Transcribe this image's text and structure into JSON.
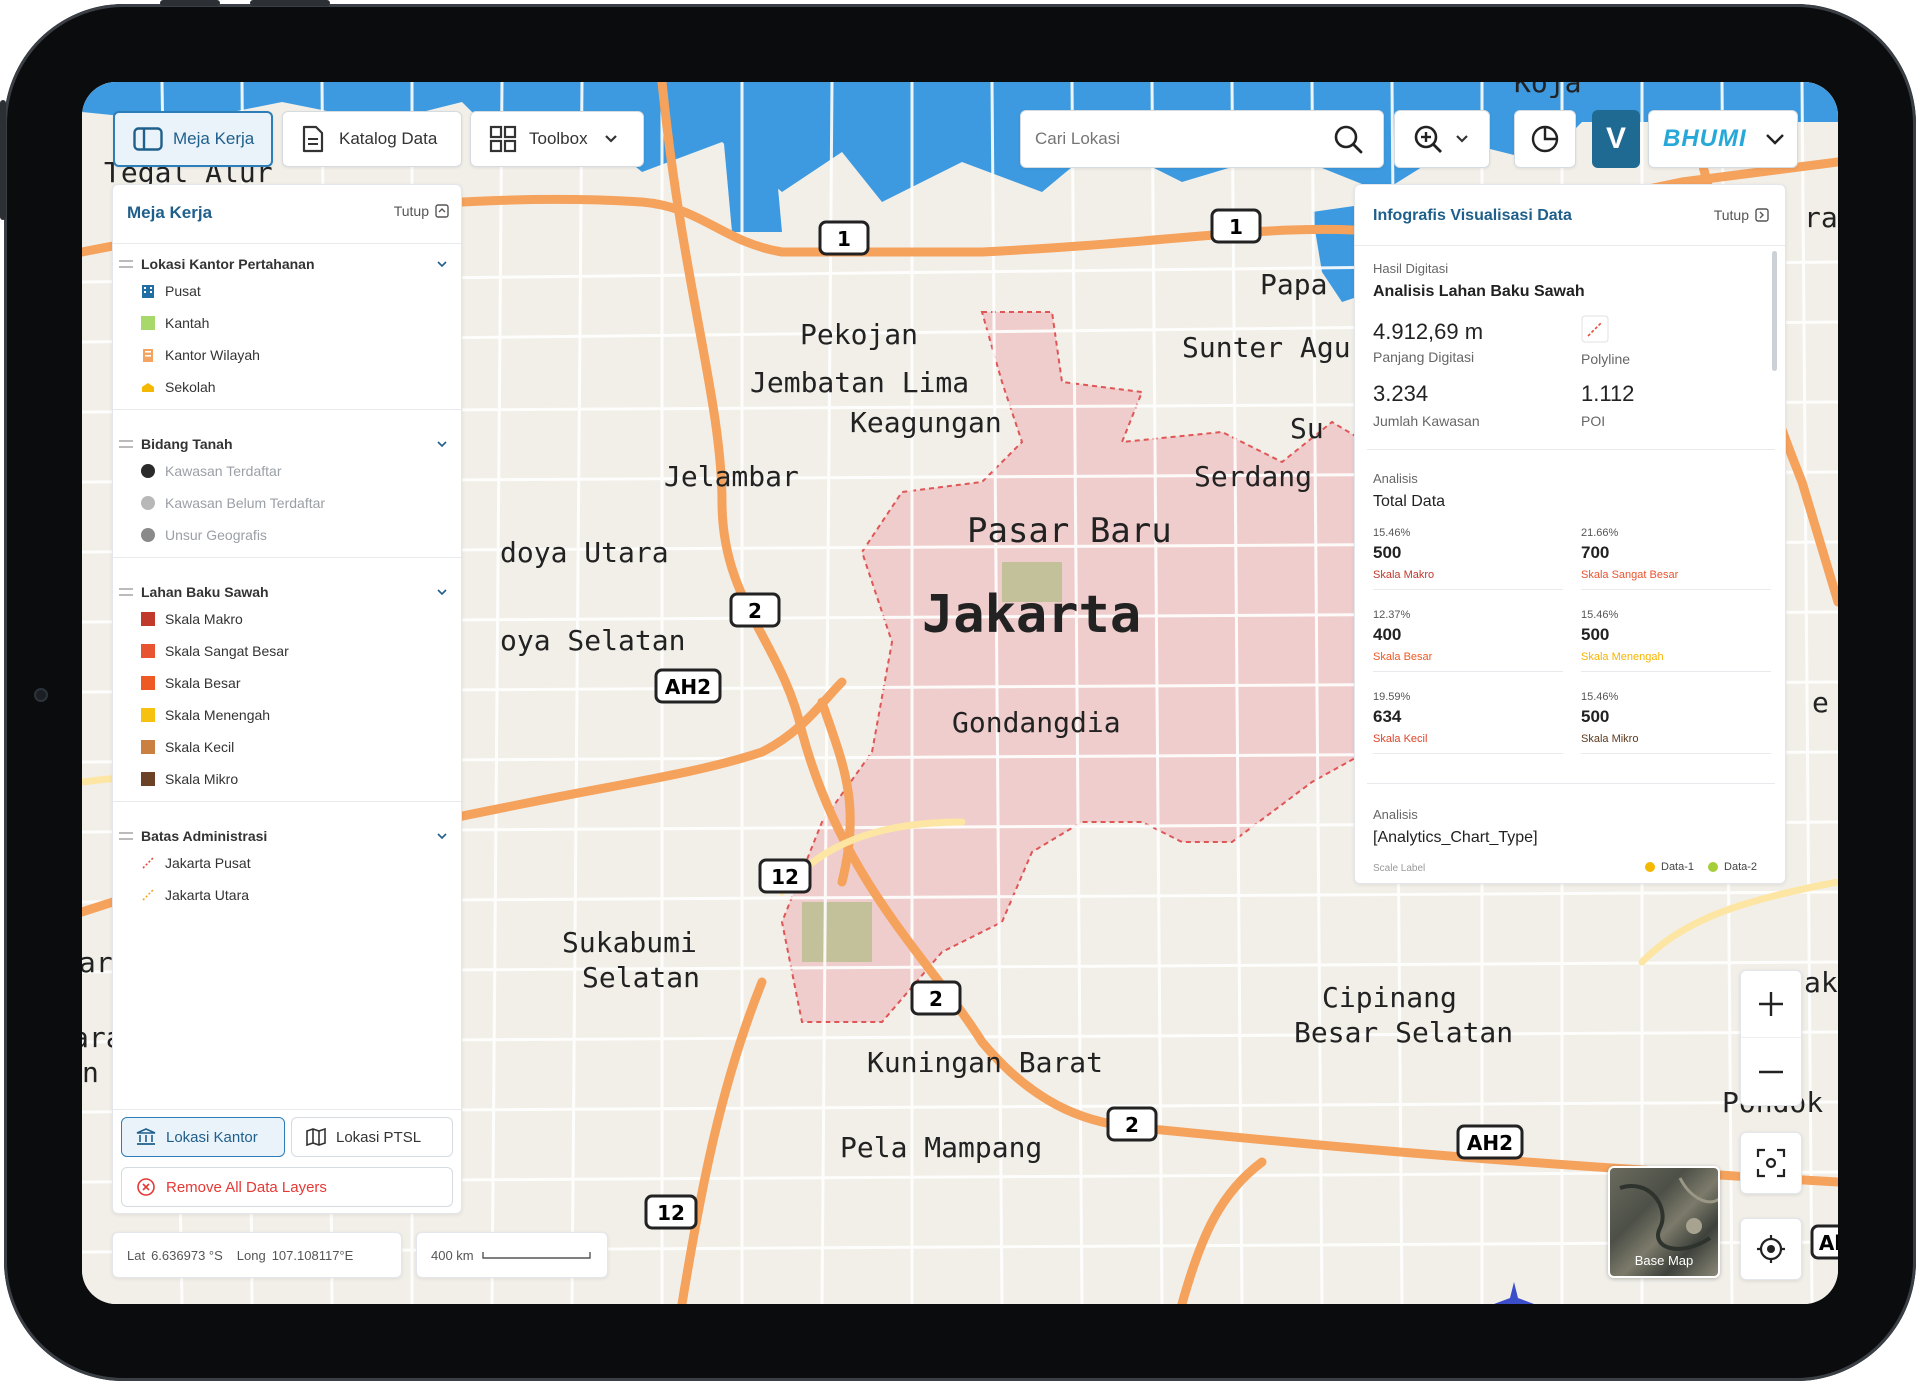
{
  "toolbar": {
    "meja_kerja": "Meja Kerja",
    "katalog_data": "Katalog Data",
    "toolbox": "Toolbox",
    "search_placeholder": "Cari Lokasi",
    "brand_initial": "V",
    "brand_name": "BHUMI"
  },
  "map_labels": {
    "city": "Jakarta",
    "pasar_baru": "Pasar Baru",
    "gondangdia": "Gondangdia",
    "pekojan": "Pekojan",
    "jembatan_lima": "Jembatan Lima",
    "keagungan": "Keagungan",
    "jelambar": "Jelambar",
    "serdang": "Serdang",
    "sunter": "Sunter Agu",
    "papa": "Papa",
    "su": "Su",
    "tegal_alur": "Tegal Alur",
    "doya_utara": "doya Utara",
    "oya_selatan": "oya Selatan",
    "sukabumi_1": "Sukabumi",
    "sukabumi_2": "Selatan",
    "cipinang_1": "Cipinang",
    "cipinang_2": "Besar Selatan",
    "kuningan": "Kuningan Barat",
    "pela": "Pela Mampang",
    "pondok": "Pondok K",
    "koja": "Koja",
    "edge_ra": "ra",
    "edge_e": "e",
    "edge_ak": "ak",
    "edge_ar": "Kar",
    "edge_ara": "ara",
    "edge_n": "n",
    "shields": [
      "1",
      "1",
      "2",
      "AH2",
      "12",
      "2",
      "2",
      "AH2",
      "12",
      "Al"
    ]
  },
  "sidebar": {
    "title": "Meja Kerja",
    "close": "Tutup",
    "groups": [
      {
        "title": "Lokasi Kantor Pertahanan",
        "items": [
          {
            "label": "Pusat",
            "color": "#1f6fa5",
            "icon": "building-icon"
          },
          {
            "label": "Kantah",
            "color": "#a6d96a",
            "icon": "square-icon"
          },
          {
            "label": "Kantor Wilayah",
            "color": "#f4a460",
            "icon": "office-icon"
          },
          {
            "label": "Sekolah",
            "color": "#f5b800",
            "icon": "school-icon"
          }
        ]
      },
      {
        "title": "Bidang Tanah",
        "items": [
          {
            "label": "Kawasan Terdaftar",
            "color": "#2b2b2b"
          },
          {
            "label": "Kawasan Belum Terdaftar",
            "color": "#b8b8b8"
          },
          {
            "label": "Unsur Geografis",
            "color": "#8a8a8a"
          }
        ]
      },
      {
        "title": "Lahan Baku Sawah",
        "items": [
          {
            "label": "Skala Makro",
            "color": "#c0392b"
          },
          {
            "label": "Skala Sangat Besar",
            "color": "#e8542f"
          },
          {
            "label": "Skala Besar",
            "color": "#ee5a24"
          },
          {
            "label": "Skala Menengah",
            "color": "#f7c10f"
          },
          {
            "label": "Skala Kecil",
            "color": "#c98040"
          },
          {
            "label": "Skala Mikro",
            "color": "#6b4226"
          }
        ]
      },
      {
        "title": "Batas Administrasi",
        "items": [
          {
            "label": "Jakarta Pusat",
            "color": "#e74c3c"
          },
          {
            "label": "Jakarta Utara",
            "color": "#f5a623"
          }
        ]
      }
    ],
    "tab_kantor": "Lokasi Kantor",
    "tab_ptsl": "Lokasi PTSL",
    "remove_all": "Remove All Data Layers"
  },
  "coords": {
    "lat_label": "Lat",
    "lat_value": "6.636973 °S",
    "long_label": "Long",
    "long_value": "107.108117°E",
    "scale": "400 km"
  },
  "infopanel": {
    "title": "Infografis Visualisasi Data",
    "close": "Tutup",
    "hasil": {
      "caption": "Hasil Digitasi",
      "title": "Analisis Lahan Baku Sawah",
      "panjang_value": "4.912,69 m",
      "panjang_label": "Panjang Digitasi",
      "type_label": "Polyline",
      "jumlah_value": "3.234",
      "jumlah_label": "Jumlah Kawasan",
      "poi_value": "1.112",
      "poi_label": "POI"
    },
    "total": {
      "caption": "Analisis",
      "title": "Total Data",
      "cells": [
        {
          "pct": "15.46%",
          "value": "500",
          "label": "Skala Makro",
          "color": "#c0392b"
        },
        {
          "pct": "21.66%",
          "value": "700",
          "label": "Skala Sangat Besar",
          "color": "#e8542f"
        },
        {
          "pct": "12.37%",
          "value": "400",
          "label": "Skala Besar",
          "color": "#ee5a24"
        },
        {
          "pct": "15.46%",
          "value": "500",
          "label": "Skala Menengah",
          "color": "#f7b500"
        },
        {
          "pct": "19.59%",
          "value": "634",
          "label": "Skala Kecil",
          "color": "#e0442a"
        },
        {
          "pct": "15.46%",
          "value": "500",
          "label": "Skala Mikro",
          "color": "#5b3a1e"
        }
      ]
    },
    "chart": {
      "caption": "Analisis",
      "title": "[Analytics_Chart_Type]",
      "scale_label": "Scale Label",
      "legend": [
        {
          "name": "Data-1",
          "color": "#f5b800"
        },
        {
          "name": "Data-2",
          "color": "#a6ce39"
        }
      ]
    }
  },
  "basemap_label": "Base Map"
}
